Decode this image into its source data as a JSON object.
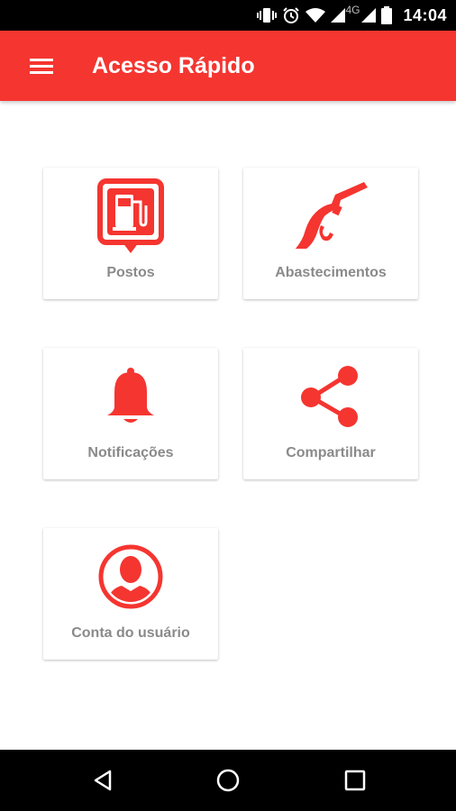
{
  "status_bar": {
    "network": "4G",
    "time": "14:04",
    "icons": [
      "vibrate-icon",
      "alarm-icon",
      "wifi-icon",
      "signal-icon",
      "signal-icon",
      "battery-icon"
    ]
  },
  "app_bar": {
    "menu_icon": "hamburger-menu-icon",
    "title": "Acesso Rápido"
  },
  "accent_color": "#f53530",
  "tiles": [
    {
      "label": "Postos",
      "icon": "gas-station-pin-icon"
    },
    {
      "label": "Abastecimentos",
      "icon": "fuel-nozzle-icon"
    },
    {
      "label": "Notificações",
      "icon": "bell-icon"
    },
    {
      "label": "Compartilhar",
      "icon": "share-icon"
    },
    {
      "label": "Conta do usuário",
      "icon": "user-account-icon"
    }
  ],
  "nav_bar": {
    "buttons": [
      "back-icon",
      "home-icon",
      "recents-icon"
    ]
  }
}
